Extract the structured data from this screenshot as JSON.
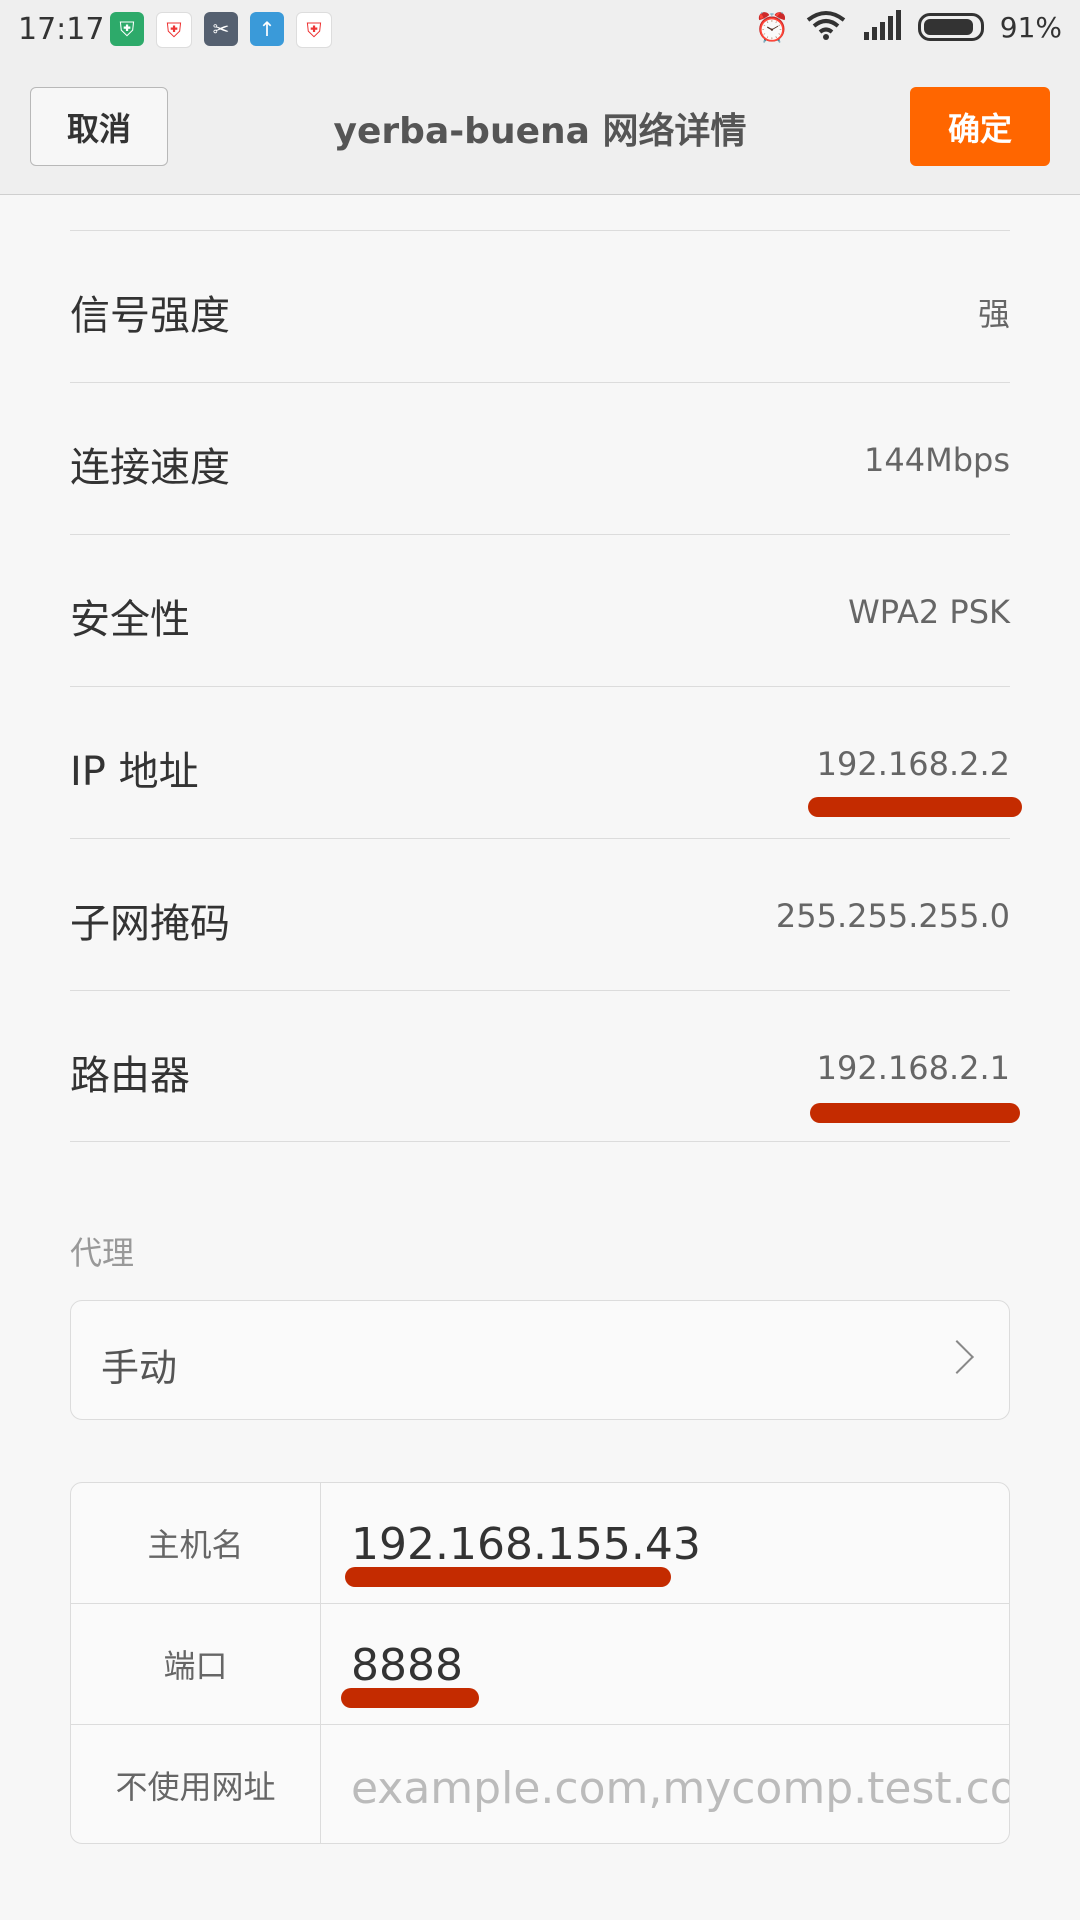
{
  "status_bar": {
    "time": "17:17",
    "battery_percent": "91%",
    "battery_level": 0.91,
    "icons": [
      "shield-icon",
      "colorful-shield-icon",
      "scissors-app-icon",
      "upload-app-icon",
      "colorful-shield-icon",
      "alarm-icon",
      "wifi-icon",
      "signal-icon",
      "battery-icon"
    ]
  },
  "header": {
    "cancel_label": "取消",
    "title": "yerba-buena 网络详情",
    "confirm_label": "确定"
  },
  "info": [
    {
      "label": "信号强度",
      "value": "强"
    },
    {
      "label": "连接速度",
      "value": "144Mbps"
    },
    {
      "label": "安全性",
      "value": "WPA2 PSK"
    },
    {
      "label": "IP 地址",
      "value": "192.168.2.2"
    },
    {
      "label": "子网掩码",
      "value": "255.255.255.0"
    },
    {
      "label": "路由器",
      "value": "192.168.2.1"
    }
  ],
  "proxy": {
    "section_label": "代理",
    "mode": "手动",
    "hostname_label": "主机名",
    "hostname_value": "192.168.155.43",
    "port_label": "端口",
    "port_value": "8888",
    "bypass_label": "不使用网址",
    "bypass_placeholder": "example.com,mycomp.test.com,l"
  },
  "colors": {
    "accent": "#ff6600",
    "annotation": "#c42b00"
  }
}
